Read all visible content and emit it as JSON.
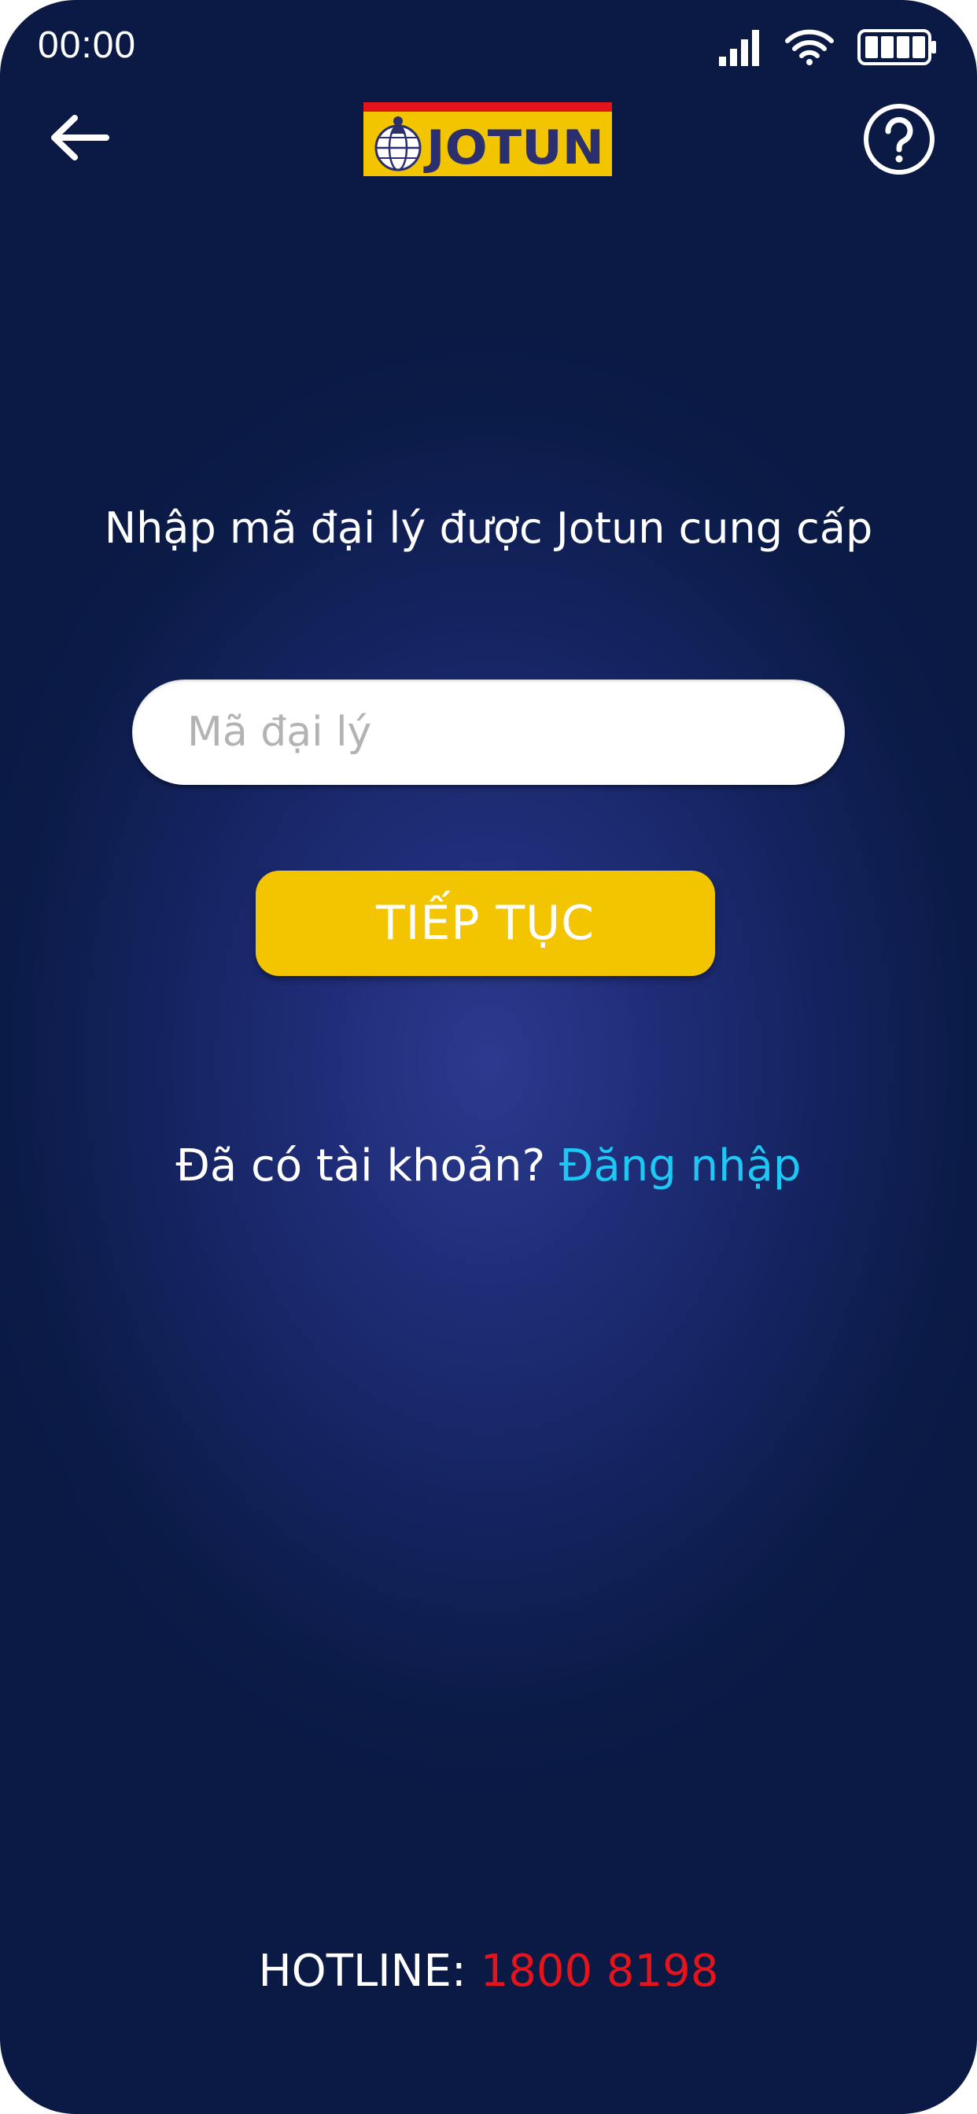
{
  "status_bar": {
    "time": "00:00",
    "icons": [
      "signal-icon",
      "wifi-icon",
      "battery-icon"
    ]
  },
  "header": {
    "back_icon": "arrow-left-icon",
    "logo_text": "JOTUN",
    "help_icon": "question-circle-icon"
  },
  "form": {
    "instruction": "Nhập mã đại lý được Jotun cung cấp",
    "code_placeholder": "Mã đại lý",
    "code_value": "",
    "continue_label": "TIẾP TỤC"
  },
  "login_prompt": {
    "question": "Đã có tài khoản? ",
    "link_label": "Đăng nhập"
  },
  "footer": {
    "hotline_label": "HOTLINE: ",
    "hotline_number": "1800 8198"
  },
  "colors": {
    "background": "#1f2d78",
    "accent_yellow": "#f2c500",
    "link_blue": "#1ec8f5",
    "hotline_red": "#e3141b",
    "logo_red": "#e3141b",
    "logo_navy": "#2b2f6e"
  }
}
